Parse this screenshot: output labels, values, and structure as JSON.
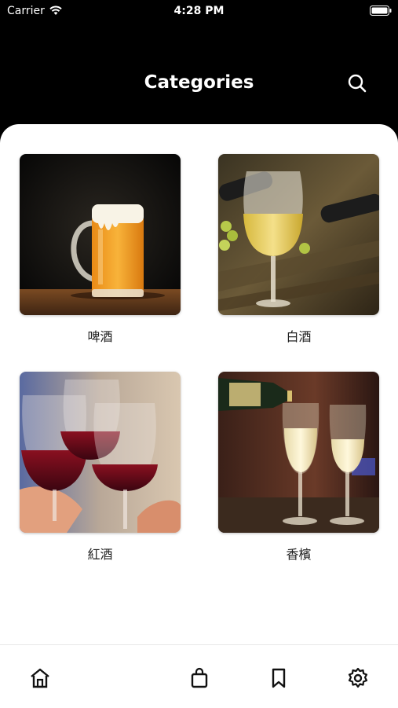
{
  "status_bar": {
    "carrier": "Carrier",
    "time": "4:28 PM"
  },
  "header": {
    "title": "Categories"
  },
  "categories": [
    {
      "label": "啤酒"
    },
    {
      "label": "白酒"
    },
    {
      "label": "紅酒"
    },
    {
      "label": "香檳"
    }
  ],
  "colors": {
    "header_bg": "#000000",
    "content_bg": "#ffffff",
    "icon": "#111111"
  },
  "tab_bar": [
    "home-icon",
    "shopping-bag-icon",
    "bookmark-icon",
    "settings-icon"
  ]
}
